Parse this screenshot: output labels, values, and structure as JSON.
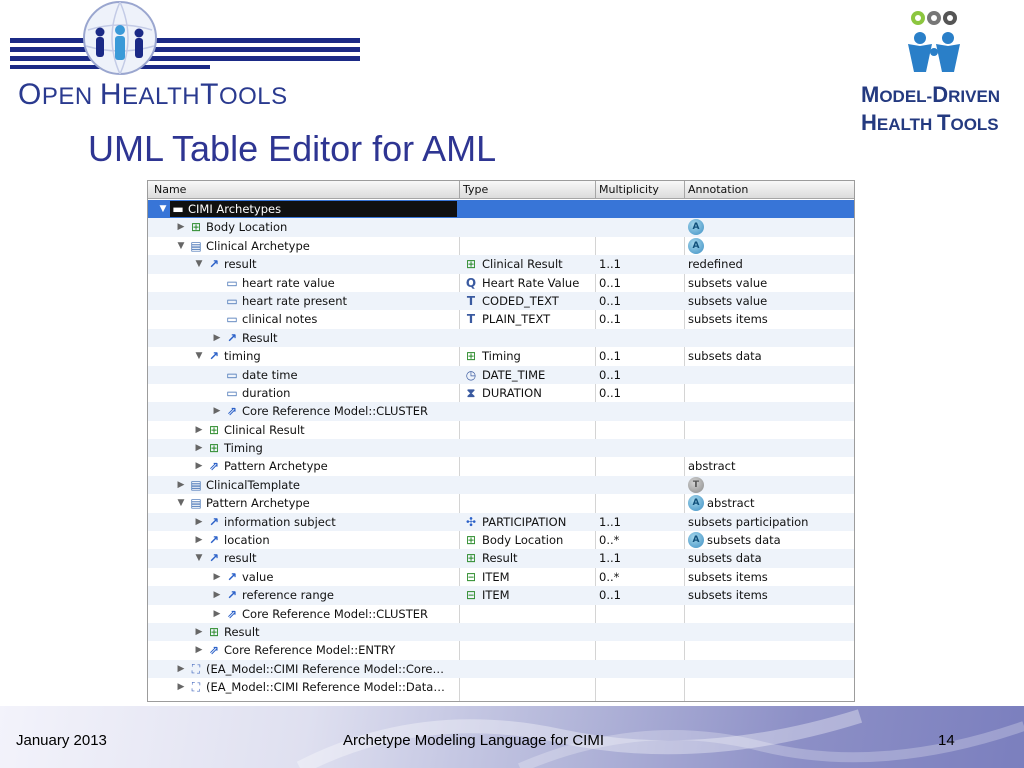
{
  "header": {
    "oht_logo": {
      "first": "O",
      "rest1": "PEN ",
      "h": "H",
      "rest2": "EALTH",
      "t": "T",
      "rest3": "OOLS"
    },
    "mdht_logo": {
      "line1a": "M",
      "line1b": "ODEL-",
      "line1c": "D",
      "line1d": "RIVEN",
      "line2a": "H",
      "line2b": "EALTH ",
      "line2c": "T",
      "line2d": "OOLS"
    }
  },
  "title": "UML Table Editor for AML",
  "table": {
    "columns": [
      "Name",
      "Type",
      "Multiplicity",
      "Annotation"
    ],
    "rows": [
      {
        "indent": 0,
        "twisty": "down",
        "icon": "folder-icon",
        "name": "CIMI Archetypes",
        "type": "",
        "type_icon": "",
        "mult": "",
        "annotation": "",
        "badge": "",
        "selected": true
      },
      {
        "indent": 1,
        "twisty": "right",
        "icon": "class-icon",
        "name": "Body Location",
        "type": "",
        "type_icon": "",
        "mult": "",
        "annotation": "",
        "badge": "A"
      },
      {
        "indent": 1,
        "twisty": "down",
        "icon": "archetype-icon",
        "name": "Clinical Archetype",
        "type": "",
        "type_icon": "",
        "mult": "",
        "annotation": "",
        "badge": "A"
      },
      {
        "indent": 2,
        "twisty": "down",
        "icon": "association-icon",
        "name": "result",
        "type": "Clinical Result",
        "type_icon": "class-icon",
        "mult": "1..1",
        "annotation": "redefined",
        "badge": ""
      },
      {
        "indent": 3,
        "twisty": "",
        "icon": "attribute-icon",
        "name": "heart rate value",
        "type": "Heart Rate Value",
        "type_icon": "quantity-icon",
        "mult": "0..1",
        "annotation": "subsets value",
        "badge": ""
      },
      {
        "indent": 3,
        "twisty": "",
        "icon": "attribute-icon",
        "name": "heart rate present",
        "type": "CODED_TEXT",
        "type_icon": "coded-text-icon",
        "mult": "0..1",
        "annotation": "subsets value",
        "badge": ""
      },
      {
        "indent": 3,
        "twisty": "",
        "icon": "attribute-icon",
        "name": "clinical notes",
        "type": "PLAIN_TEXT",
        "type_icon": "text-icon",
        "mult": "0..1",
        "annotation": "subsets items",
        "badge": ""
      },
      {
        "indent": 3,
        "twisty": "right",
        "icon": "association-icon",
        "name": "Result",
        "type": "",
        "type_icon": "",
        "mult": "",
        "annotation": "",
        "badge": ""
      },
      {
        "indent": 2,
        "twisty": "down",
        "icon": "association-icon",
        "name": "timing",
        "type": "Timing",
        "type_icon": "class-icon",
        "mult": "0..1",
        "annotation": "subsets data",
        "badge": ""
      },
      {
        "indent": 3,
        "twisty": "",
        "icon": "attribute-icon",
        "name": "date time",
        "type": "DATE_TIME",
        "type_icon": "datetime-icon",
        "mult": "0..1",
        "annotation": "",
        "badge": ""
      },
      {
        "indent": 3,
        "twisty": "",
        "icon": "attribute-icon",
        "name": "duration",
        "type": "DURATION",
        "type_icon": "hourglass-icon",
        "mult": "0..1",
        "annotation": "",
        "badge": ""
      },
      {
        "indent": 3,
        "twisty": "right",
        "icon": "association-outline-icon",
        "name": "Core Reference Model::CLUSTER",
        "type": "",
        "type_icon": "",
        "mult": "",
        "annotation": "",
        "badge": ""
      },
      {
        "indent": 2,
        "twisty": "right",
        "icon": "class-icon",
        "name": "Clinical Result",
        "type": "",
        "type_icon": "",
        "mult": "",
        "annotation": "",
        "badge": ""
      },
      {
        "indent": 2,
        "twisty": "right",
        "icon": "class-icon",
        "name": "Timing",
        "type": "",
        "type_icon": "",
        "mult": "",
        "annotation": "",
        "badge": ""
      },
      {
        "indent": 2,
        "twisty": "right",
        "icon": "association-outline-icon",
        "name": "Pattern Archetype",
        "type": "",
        "type_icon": "",
        "mult": "",
        "annotation": "abstract",
        "badge": ""
      },
      {
        "indent": 1,
        "twisty": "right",
        "icon": "archetype-icon",
        "name": "ClinicalTemplate",
        "type": "",
        "type_icon": "",
        "mult": "",
        "annotation": "",
        "badge": "T"
      },
      {
        "indent": 1,
        "twisty": "down",
        "icon": "archetype-icon",
        "name": "Pattern Archetype",
        "type": "",
        "type_icon": "",
        "mult": "",
        "annotation": "abstract",
        "badge": "A"
      },
      {
        "indent": 2,
        "twisty": "right",
        "icon": "association-icon",
        "name": "information subject",
        "type": "PARTICIPATION",
        "type_icon": "participation-icon",
        "mult": "1..1",
        "annotation": "subsets participation",
        "badge": ""
      },
      {
        "indent": 2,
        "twisty": "right",
        "icon": "association-icon",
        "name": "location",
        "type": "Body Location",
        "type_icon": "class-icon",
        "mult": "0..*",
        "annotation": "subsets data",
        "badge": "A"
      },
      {
        "indent": 2,
        "twisty": "down",
        "icon": "association-icon",
        "name": "result",
        "type": "Result",
        "type_icon": "class-icon",
        "mult": "1..1",
        "annotation": "subsets data",
        "badge": ""
      },
      {
        "indent": 3,
        "twisty": "right",
        "icon": "association-icon",
        "name": "value",
        "type": "ITEM",
        "type_icon": "class-outline-icon",
        "mult": "0..*",
        "annotation": "subsets items",
        "badge": ""
      },
      {
        "indent": 3,
        "twisty": "right",
        "icon": "association-icon",
        "name": "reference range",
        "type": "ITEM",
        "type_icon": "class-outline-icon",
        "mult": "0..1",
        "annotation": "subsets items",
        "badge": ""
      },
      {
        "indent": 3,
        "twisty": "right",
        "icon": "association-outline-icon",
        "name": "Core Reference Model::CLUSTER",
        "type": "",
        "type_icon": "",
        "mult": "",
        "annotation": "",
        "badge": ""
      },
      {
        "indent": 2,
        "twisty": "right",
        "icon": "class-icon",
        "name": "Result",
        "type": "",
        "type_icon": "",
        "mult": "",
        "annotation": "",
        "badge": ""
      },
      {
        "indent": 2,
        "twisty": "right",
        "icon": "association-outline-icon",
        "name": "Core Reference Model::ENTRY",
        "type": "",
        "type_icon": "",
        "mult": "",
        "annotation": "",
        "badge": ""
      },
      {
        "indent": 1,
        "twisty": "right",
        "icon": "ea-model-icon",
        "name": "(EA_Model::CIMI Reference Model::Core…",
        "type": "",
        "type_icon": "",
        "mult": "",
        "annotation": "",
        "badge": ""
      },
      {
        "indent": 1,
        "twisty": "right",
        "icon": "ea-model-icon",
        "name": "(EA_Model::CIMI Reference Model::Data…",
        "type": "",
        "type_icon": "",
        "mult": "",
        "annotation": "",
        "badge": ""
      }
    ]
  },
  "footer": {
    "date": "January 2013",
    "subject": "Archetype Modeling Language for CIMI",
    "page": "14"
  }
}
